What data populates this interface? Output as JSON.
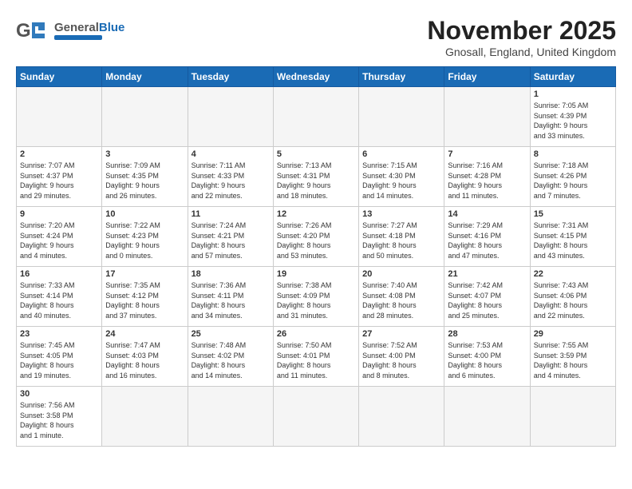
{
  "header": {
    "logo_general": "General",
    "logo_blue": "Blue",
    "month_title": "November 2025",
    "location": "Gnosall, England, United Kingdom"
  },
  "days_of_week": [
    "Sunday",
    "Monday",
    "Tuesday",
    "Wednesday",
    "Thursday",
    "Friday",
    "Saturday"
  ],
  "weeks": [
    [
      {
        "day": "",
        "info": ""
      },
      {
        "day": "",
        "info": ""
      },
      {
        "day": "",
        "info": ""
      },
      {
        "day": "",
        "info": ""
      },
      {
        "day": "",
        "info": ""
      },
      {
        "day": "",
        "info": ""
      },
      {
        "day": "1",
        "info": "Sunrise: 7:05 AM\nSunset: 4:39 PM\nDaylight: 9 hours\nand 33 minutes."
      }
    ],
    [
      {
        "day": "2",
        "info": "Sunrise: 7:07 AM\nSunset: 4:37 PM\nDaylight: 9 hours\nand 29 minutes."
      },
      {
        "day": "3",
        "info": "Sunrise: 7:09 AM\nSunset: 4:35 PM\nDaylight: 9 hours\nand 26 minutes."
      },
      {
        "day": "4",
        "info": "Sunrise: 7:11 AM\nSunset: 4:33 PM\nDaylight: 9 hours\nand 22 minutes."
      },
      {
        "day": "5",
        "info": "Sunrise: 7:13 AM\nSunset: 4:31 PM\nDaylight: 9 hours\nand 18 minutes."
      },
      {
        "day": "6",
        "info": "Sunrise: 7:15 AM\nSunset: 4:30 PM\nDaylight: 9 hours\nand 14 minutes."
      },
      {
        "day": "7",
        "info": "Sunrise: 7:16 AM\nSunset: 4:28 PM\nDaylight: 9 hours\nand 11 minutes."
      },
      {
        "day": "8",
        "info": "Sunrise: 7:18 AM\nSunset: 4:26 PM\nDaylight: 9 hours\nand 7 minutes."
      }
    ],
    [
      {
        "day": "9",
        "info": "Sunrise: 7:20 AM\nSunset: 4:24 PM\nDaylight: 9 hours\nand 4 minutes."
      },
      {
        "day": "10",
        "info": "Sunrise: 7:22 AM\nSunset: 4:23 PM\nDaylight: 9 hours\nand 0 minutes."
      },
      {
        "day": "11",
        "info": "Sunrise: 7:24 AM\nSunset: 4:21 PM\nDaylight: 8 hours\nand 57 minutes."
      },
      {
        "day": "12",
        "info": "Sunrise: 7:26 AM\nSunset: 4:20 PM\nDaylight: 8 hours\nand 53 minutes."
      },
      {
        "day": "13",
        "info": "Sunrise: 7:27 AM\nSunset: 4:18 PM\nDaylight: 8 hours\nand 50 minutes."
      },
      {
        "day": "14",
        "info": "Sunrise: 7:29 AM\nSunset: 4:16 PM\nDaylight: 8 hours\nand 47 minutes."
      },
      {
        "day": "15",
        "info": "Sunrise: 7:31 AM\nSunset: 4:15 PM\nDaylight: 8 hours\nand 43 minutes."
      }
    ],
    [
      {
        "day": "16",
        "info": "Sunrise: 7:33 AM\nSunset: 4:14 PM\nDaylight: 8 hours\nand 40 minutes."
      },
      {
        "day": "17",
        "info": "Sunrise: 7:35 AM\nSunset: 4:12 PM\nDaylight: 8 hours\nand 37 minutes."
      },
      {
        "day": "18",
        "info": "Sunrise: 7:36 AM\nSunset: 4:11 PM\nDaylight: 8 hours\nand 34 minutes."
      },
      {
        "day": "19",
        "info": "Sunrise: 7:38 AM\nSunset: 4:09 PM\nDaylight: 8 hours\nand 31 minutes."
      },
      {
        "day": "20",
        "info": "Sunrise: 7:40 AM\nSunset: 4:08 PM\nDaylight: 8 hours\nand 28 minutes."
      },
      {
        "day": "21",
        "info": "Sunrise: 7:42 AM\nSunset: 4:07 PM\nDaylight: 8 hours\nand 25 minutes."
      },
      {
        "day": "22",
        "info": "Sunrise: 7:43 AM\nSunset: 4:06 PM\nDaylight: 8 hours\nand 22 minutes."
      }
    ],
    [
      {
        "day": "23",
        "info": "Sunrise: 7:45 AM\nSunset: 4:05 PM\nDaylight: 8 hours\nand 19 minutes."
      },
      {
        "day": "24",
        "info": "Sunrise: 7:47 AM\nSunset: 4:03 PM\nDaylight: 8 hours\nand 16 minutes."
      },
      {
        "day": "25",
        "info": "Sunrise: 7:48 AM\nSunset: 4:02 PM\nDaylight: 8 hours\nand 14 minutes."
      },
      {
        "day": "26",
        "info": "Sunrise: 7:50 AM\nSunset: 4:01 PM\nDaylight: 8 hours\nand 11 minutes."
      },
      {
        "day": "27",
        "info": "Sunrise: 7:52 AM\nSunset: 4:00 PM\nDaylight: 8 hours\nand 8 minutes."
      },
      {
        "day": "28",
        "info": "Sunrise: 7:53 AM\nSunset: 4:00 PM\nDaylight: 8 hours\nand 6 minutes."
      },
      {
        "day": "29",
        "info": "Sunrise: 7:55 AM\nSunset: 3:59 PM\nDaylight: 8 hours\nand 4 minutes."
      }
    ],
    [
      {
        "day": "30",
        "info": "Sunrise: 7:56 AM\nSunset: 3:58 PM\nDaylight: 8 hours\nand 1 minute."
      },
      {
        "day": "",
        "info": ""
      },
      {
        "day": "",
        "info": ""
      },
      {
        "day": "",
        "info": ""
      },
      {
        "day": "",
        "info": ""
      },
      {
        "day": "",
        "info": ""
      },
      {
        "day": "",
        "info": ""
      }
    ]
  ]
}
